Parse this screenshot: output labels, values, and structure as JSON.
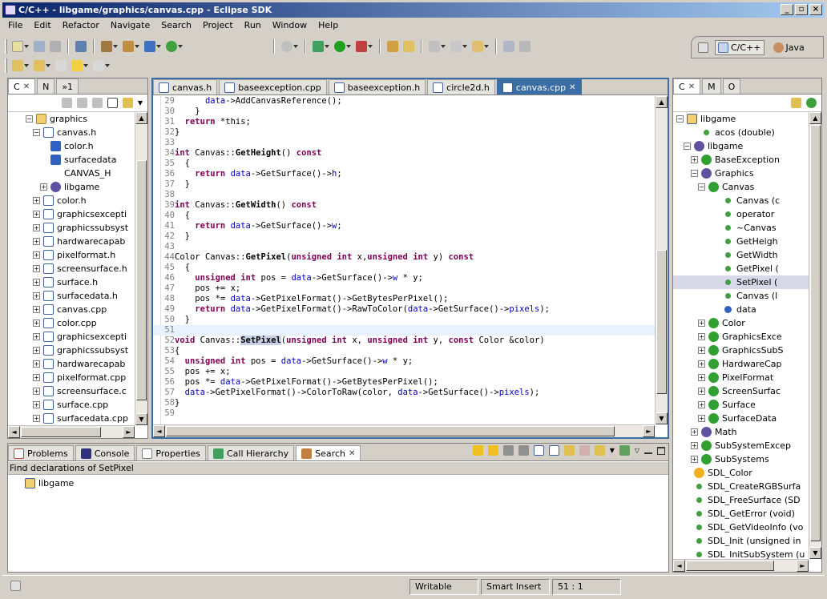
{
  "window": {
    "title": "C/C++ - libgame/graphics/canvas.cpp - Eclipse SDK"
  },
  "menu": [
    "File",
    "Edit",
    "Refactor",
    "Navigate",
    "Search",
    "Project",
    "Run",
    "Window",
    "Help"
  ],
  "perspectives": [
    {
      "label": "C/C++",
      "active": true
    },
    {
      "label": "Java",
      "active": false
    }
  ],
  "left_panel": {
    "tabs": [
      {
        "label": "C",
        "active": true
      },
      {
        "label": "N",
        "active": false
      },
      {
        "label": "»1",
        "active": false
      }
    ],
    "tree": [
      {
        "label": "graphics",
        "indent": 2,
        "exp": "-",
        "icon": "folder-icon"
      },
      {
        "label": "canvas.h",
        "indent": 3,
        "exp": "-",
        "icon": "header-file-icon"
      },
      {
        "label": "color.h",
        "indent": 4,
        "exp": "",
        "icon": "include-icon"
      },
      {
        "label": "surfacedata",
        "indent": 4,
        "exp": "",
        "icon": "include-icon"
      },
      {
        "label": "CANVAS_H",
        "indent": 4,
        "exp": "",
        "icon": "macro-icon"
      },
      {
        "label": "libgame",
        "indent": 4,
        "exp": "+",
        "icon": "namespace-icon"
      },
      {
        "label": "color.h",
        "indent": 3,
        "exp": "+",
        "icon": "header-file-icon"
      },
      {
        "label": "graphicsexcepti",
        "indent": 3,
        "exp": "+",
        "icon": "header-file-icon"
      },
      {
        "label": "graphicssubsyst",
        "indent": 3,
        "exp": "+",
        "icon": "header-file-icon"
      },
      {
        "label": "hardwarecapab",
        "indent": 3,
        "exp": "+",
        "icon": "header-file-icon"
      },
      {
        "label": "pixelformat.h",
        "indent": 3,
        "exp": "+",
        "icon": "header-file-icon"
      },
      {
        "label": "screensurface.h",
        "indent": 3,
        "exp": "+",
        "icon": "header-file-icon"
      },
      {
        "label": "surface.h",
        "indent": 3,
        "exp": "+",
        "icon": "header-file-icon"
      },
      {
        "label": "surfacedata.h",
        "indent": 3,
        "exp": "+",
        "icon": "header-file-icon"
      },
      {
        "label": "canvas.cpp",
        "indent": 3,
        "exp": "+",
        "icon": "source-file-icon"
      },
      {
        "label": "color.cpp",
        "indent": 3,
        "exp": "+",
        "icon": "source-file-icon"
      },
      {
        "label": "graphicsexcepti",
        "indent": 3,
        "exp": "+",
        "icon": "source-file-icon"
      },
      {
        "label": "graphicssubsyst",
        "indent": 3,
        "exp": "+",
        "icon": "source-file-icon"
      },
      {
        "label": "hardwarecapab",
        "indent": 3,
        "exp": "+",
        "icon": "source-file-icon"
      },
      {
        "label": "pixelformat.cpp",
        "indent": 3,
        "exp": "+",
        "icon": "source-file-icon"
      },
      {
        "label": "screensurface.c",
        "indent": 3,
        "exp": "+",
        "icon": "source-file-icon"
      },
      {
        "label": "surface.cpp",
        "indent": 3,
        "exp": "+",
        "icon": "source-file-icon"
      },
      {
        "label": "surfacedata.cpp",
        "indent": 3,
        "exp": "+",
        "icon": "source-file-icon"
      }
    ]
  },
  "editor": {
    "tabs": [
      {
        "label": "canvas.h",
        "icon": "header-file-icon",
        "active": false
      },
      {
        "label": "baseexception.cpp",
        "icon": "source-file-icon",
        "active": false
      },
      {
        "label": "baseexception.h",
        "icon": "header-file-icon",
        "active": false
      },
      {
        "label": "circle2d.h",
        "icon": "header-file-icon",
        "active": false
      },
      {
        "label": "canvas.cpp",
        "icon": "source-file-icon",
        "active": true
      }
    ],
    "lines": [
      {
        "n": "29",
        "t": "      data->AddCanvasReference();"
      },
      {
        "n": "30",
        "t": "    }"
      },
      {
        "n": "31",
        "t": "  return *this;"
      },
      {
        "n": "32",
        "t": "}"
      },
      {
        "n": "33",
        "t": ""
      },
      {
        "n": "34",
        "t": "int Canvas::GetHeight() const"
      },
      {
        "n": "35",
        "t": "  {"
      },
      {
        "n": "36",
        "t": "    return data->GetSurface()->h;"
      },
      {
        "n": "37",
        "t": "  }"
      },
      {
        "n": "38",
        "t": ""
      },
      {
        "n": "39",
        "t": "int Canvas::GetWidth() const"
      },
      {
        "n": "40",
        "t": "  {"
      },
      {
        "n": "41",
        "t": "    return data->GetSurface()->w;"
      },
      {
        "n": "42",
        "t": "  }"
      },
      {
        "n": "43",
        "t": ""
      },
      {
        "n": "44",
        "t": "Color Canvas::GetPixel(unsigned int x,unsigned int y) const"
      },
      {
        "n": "45",
        "t": "  {"
      },
      {
        "n": "46",
        "t": "    unsigned int pos = data->GetSurface()->w * y;"
      },
      {
        "n": "47",
        "t": "    pos += x;"
      },
      {
        "n": "48",
        "t": "    pos *= data->GetPixelFormat()->GetBytesPerPixel();"
      },
      {
        "n": "49",
        "t": "    return data->GetPixelFormat()->RawToColor(data->GetSurface()->pixels);"
      },
      {
        "n": "50",
        "t": "  }"
      },
      {
        "n": "51",
        "t": ""
      },
      {
        "n": "52",
        "t": "void Canvas::SetPixel(unsigned int x, unsigned int y, const Color &color)"
      },
      {
        "n": "53",
        "t": "{"
      },
      {
        "n": "54",
        "t": "  unsigned int pos = data->GetSurface()->w * y;"
      },
      {
        "n": "55",
        "t": "  pos += x;"
      },
      {
        "n": "56",
        "t": "  pos *= data->GetPixelFormat()->GetBytesPerPixel();"
      },
      {
        "n": "57",
        "t": "  data->GetPixelFormat()->ColorToRaw(color, data->GetSurface()->pixels);"
      },
      {
        "n": "58",
        "t": "}"
      },
      {
        "n": "59",
        "t": ""
      }
    ]
  },
  "bottom_panel": {
    "tabs": [
      {
        "label": "Problems",
        "icon": "problems-icon",
        "active": false
      },
      {
        "label": "Console",
        "icon": "console-icon",
        "active": false
      },
      {
        "label": "Properties",
        "icon": "properties-icon",
        "active": false
      },
      {
        "label": "Call Hierarchy",
        "icon": "call-hierarchy-icon",
        "active": false
      },
      {
        "label": "Search",
        "icon": "search-icon",
        "active": true
      }
    ],
    "heading": "Find declarations of SetPixel",
    "results": [
      {
        "label": "libgame",
        "icon": "project-icon"
      }
    ]
  },
  "right_panel": {
    "tabs": [
      {
        "label": "C",
        "active": true
      },
      {
        "label": "M",
        "active": false
      },
      {
        "label": "O",
        "active": false
      }
    ],
    "tree": [
      {
        "label": "libgame",
        "indent": 0,
        "exp": "-",
        "icon": "project-icon"
      },
      {
        "label": "acos (double)",
        "indent": 2,
        "exp": "",
        "icon": "function-icon"
      },
      {
        "label": "libgame",
        "indent": 1,
        "exp": "-",
        "icon": "namespace-icon"
      },
      {
        "label": "BaseException",
        "indent": 2,
        "exp": "+",
        "icon": "class-icon"
      },
      {
        "label": "Graphics",
        "indent": 2,
        "exp": "-",
        "icon": "namespace-icon"
      },
      {
        "label": "Canvas",
        "indent": 3,
        "exp": "-",
        "icon": "class-icon"
      },
      {
        "label": "Canvas (c",
        "indent": 5,
        "exp": "",
        "icon": "method-icon"
      },
      {
        "label": "operator",
        "indent": 5,
        "exp": "",
        "icon": "method-icon"
      },
      {
        "label": "~Canvas",
        "indent": 5,
        "exp": "",
        "icon": "method-icon"
      },
      {
        "label": "GetHeigh",
        "indent": 5,
        "exp": "",
        "icon": "method-icon"
      },
      {
        "label": "GetWidth",
        "indent": 5,
        "exp": "",
        "icon": "method-icon"
      },
      {
        "label": "GetPixel (",
        "indent": 5,
        "exp": "",
        "icon": "method-icon"
      },
      {
        "label": "SetPixel (",
        "indent": 5,
        "exp": "",
        "icon": "method-icon",
        "selected": true
      },
      {
        "label": "Canvas (l",
        "indent": 5,
        "exp": "",
        "icon": "method-icon"
      },
      {
        "label": "data",
        "indent": 5,
        "exp": "",
        "icon": "field-icon"
      },
      {
        "label": "Color",
        "indent": 3,
        "exp": "+",
        "icon": "class-icon"
      },
      {
        "label": "GraphicsExce",
        "indent": 3,
        "exp": "+",
        "icon": "class-icon"
      },
      {
        "label": "GraphicsSubS",
        "indent": 3,
        "exp": "+",
        "icon": "class-icon"
      },
      {
        "label": "HardwareCap",
        "indent": 3,
        "exp": "+",
        "icon": "class-icon"
      },
      {
        "label": "PixelFormat",
        "indent": 3,
        "exp": "+",
        "icon": "class-icon"
      },
      {
        "label": "ScreenSurfac",
        "indent": 3,
        "exp": "+",
        "icon": "class-icon"
      },
      {
        "label": "Surface",
        "indent": 3,
        "exp": "+",
        "icon": "class-icon"
      },
      {
        "label": "SurfaceData",
        "indent": 3,
        "exp": "+",
        "icon": "class-icon"
      },
      {
        "label": "Math",
        "indent": 2,
        "exp": "+",
        "icon": "namespace-icon"
      },
      {
        "label": "SubSystemExcep",
        "indent": 2,
        "exp": "+",
        "icon": "class-icon"
      },
      {
        "label": "SubSystems",
        "indent": 2,
        "exp": "+",
        "icon": "class-icon"
      },
      {
        "label": "SDL_Color",
        "indent": 1,
        "exp": "",
        "icon": "typedef-icon"
      },
      {
        "label": "SDL_CreateRGBSurfa",
        "indent": 1,
        "exp": "",
        "icon": "function-icon"
      },
      {
        "label": "SDL_FreeSurface (SD",
        "indent": 1,
        "exp": "",
        "icon": "function-icon"
      },
      {
        "label": "SDL_GetError (void)",
        "indent": 1,
        "exp": "",
        "icon": "function-icon"
      },
      {
        "label": "SDL_GetVideoInfo (vo",
        "indent": 1,
        "exp": "",
        "icon": "function-icon"
      },
      {
        "label": "SDL_Init (unsigned in",
        "indent": 1,
        "exp": "",
        "icon": "function-icon"
      },
      {
        "label": "SDL_InitSubSystem (u",
        "indent": 1,
        "exp": "",
        "icon": "function-icon"
      }
    ]
  },
  "status": {
    "writable": "Writable",
    "insert_mode": "Smart Insert",
    "position": "51 : 1"
  }
}
